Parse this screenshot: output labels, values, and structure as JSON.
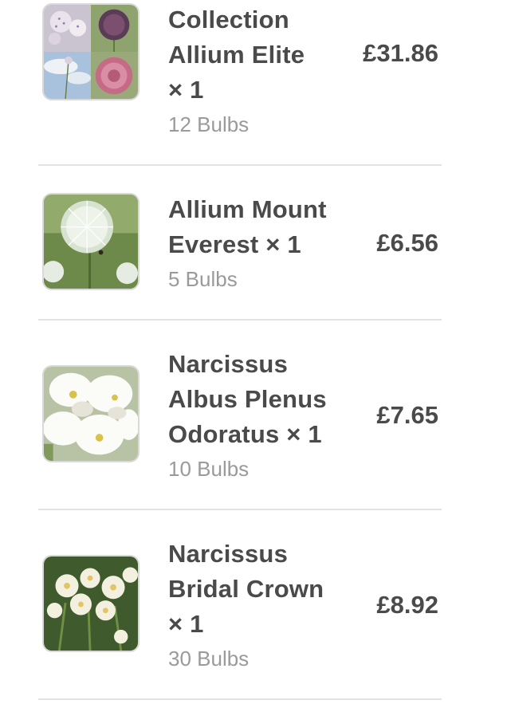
{
  "items": [
    {
      "name": "Collection Allium Elite",
      "qty": "× 1",
      "bulbs": "12 Bulbs",
      "price": "£31.86",
      "image_icon": "allium-collection-photo"
    },
    {
      "name": "Allium Mount Everest",
      "qty": "× 1",
      "bulbs": "5 Bulbs",
      "price": "£6.56",
      "image_icon": "white-allium-photo"
    },
    {
      "name": "Narcissus Albus Plenus Odoratus",
      "qty": "× 1",
      "bulbs": "10 Bulbs",
      "price": "£7.65",
      "image_icon": "white-narcissus-photo"
    },
    {
      "name": "Narcissus Bridal Crown",
      "qty": "× 1",
      "bulbs": "30 Bulbs",
      "price": "£8.92",
      "image_icon": "cream-narcissus-photo"
    }
  ],
  "colors": {
    "text_primary": "#4a4a4a",
    "text_secondary": "#9a9a9a",
    "divider": "#e3e3e3"
  }
}
